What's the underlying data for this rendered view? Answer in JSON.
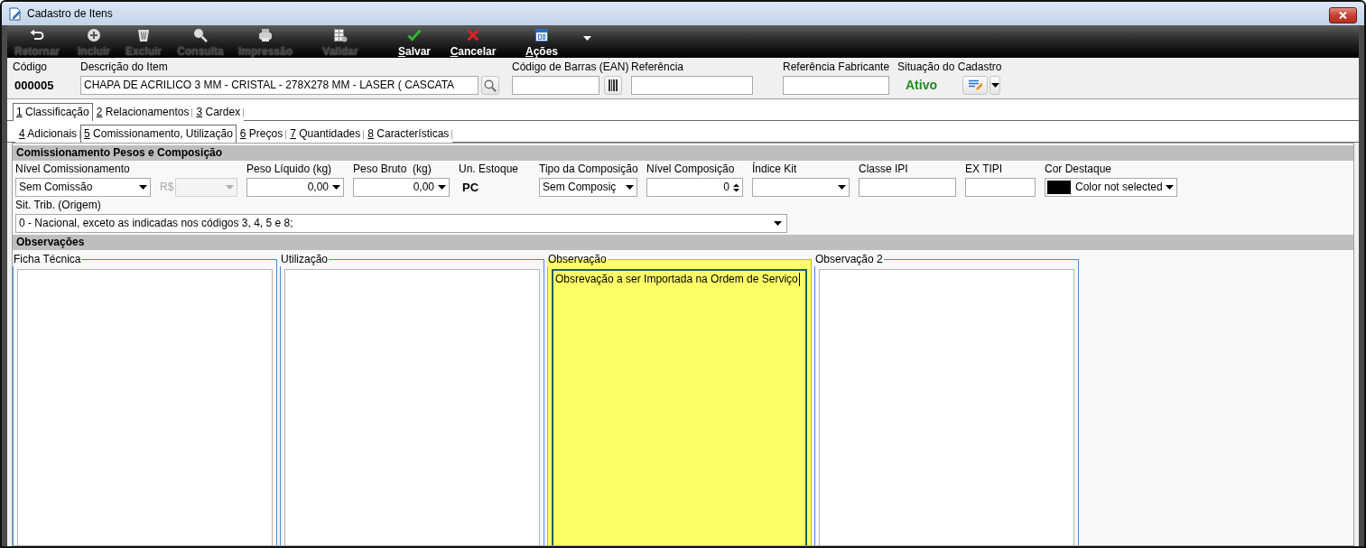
{
  "window": {
    "title": "Cadastro de Itens"
  },
  "toolbar": {
    "buttons": [
      {
        "label": "Retornar",
        "disabled": true
      },
      {
        "label": "Incluir",
        "disabled": true
      },
      {
        "label": "Excluir",
        "disabled": true
      },
      {
        "label": "Consulta",
        "disabled": true
      },
      {
        "label": "Impressão",
        "disabled": true
      },
      {
        "label": "Validar",
        "disabled": true
      },
      {
        "label": "Salvar",
        "disabled": false
      },
      {
        "label": "Cancelar",
        "disabled": false
      },
      {
        "label": "Ações",
        "disabled": false
      }
    ]
  },
  "header": {
    "fields": [
      {
        "kind": "display",
        "label": "Código",
        "value": "000005"
      },
      {
        "kind": "search",
        "label": "Descrição do Item",
        "value": "CHAPA DE ACRILICO 3 MM - CRISTAL - 278X278 MM - LASER ( CASCATA"
      },
      {
        "kind": "barcode",
        "label": "Código de Barras (EAN)"
      },
      {
        "kind": "text",
        "label": "Referência"
      },
      {
        "kind": "text",
        "label": "Referência Fabricante"
      },
      {
        "kind": "status",
        "label": "Situação do Cadastro",
        "value": "Ativo"
      }
    ]
  },
  "tab_rows": [
    {
      "tabs": [
        {
          "label": "1 Classificação",
          "selected": true
        },
        {
          "label": "2 Relacionamentos",
          "selected": false
        },
        {
          "label": "3 Cardex",
          "selected": false
        }
      ]
    },
    {
      "tabs": [
        {
          "label": "4 Adicionais",
          "selected": false
        },
        {
          "label": "5 Comissionamento, Utilização",
          "selected": true
        },
        {
          "label": "6 Preços",
          "selected": false
        },
        {
          "label": "7 Quantidades",
          "selected": false
        },
        {
          "label": "8 Características",
          "selected": false
        }
      ]
    }
  ],
  "commission": {
    "title": "Comissionamento Pesos e Composição",
    "fields": [
      {
        "kind": "select",
        "label": "Nível Comissionamento",
        "value": "Sem Comissão",
        "disabled": false
      },
      {
        "kind": "currency",
        "label": "R$",
        "disabled": true
      },
      {
        "kind": "amount",
        "label": "Peso Líquido (kg)",
        "value": "0,00",
        "disabled": false
      },
      {
        "kind": "amount",
        "label": "Peso Bruto  (kg)",
        "value": "0,00",
        "disabled": false
      },
      {
        "kind": "display",
        "label": "Un. Estoque",
        "value": "PC",
        "disabled": false
      },
      {
        "kind": "select",
        "label": "Tipo da Composição",
        "value": "Sem Composiç",
        "disabled": false
      },
      {
        "kind": "spin",
        "label": "Nível Composição",
        "value": "0",
        "disabled": false
      },
      {
        "kind": "select",
        "label": "Índice Kit",
        "disabled": false
      },
      {
        "kind": "text",
        "label": "Classe IPI",
        "disabled": false
      },
      {
        "kind": "text",
        "label": "EX TIPI",
        "disabled": false
      },
      {
        "kind": "color",
        "label": "Cor Destaque",
        "value": "Color not selected",
        "color": "#000000",
        "disabled": false
      }
    ],
    "origin": {
      "label": "Sit. Trib. (Origem)",
      "value": "0 - Nacional, exceto as indicadas nos códigos 3, 4, 5 e 8;"
    }
  },
  "observations": {
    "title": "Observações",
    "boxes": [
      {
        "title": "Ficha Técnica",
        "focused": false
      },
      {
        "title": "Utilização",
        "focused": false
      },
      {
        "title": "Observação",
        "focused": true,
        "text": "Obsrevação a ser Importada na Ordem de Serviço"
      },
      {
        "title": "Observação 2",
        "focused": false
      }
    ]
  }
}
